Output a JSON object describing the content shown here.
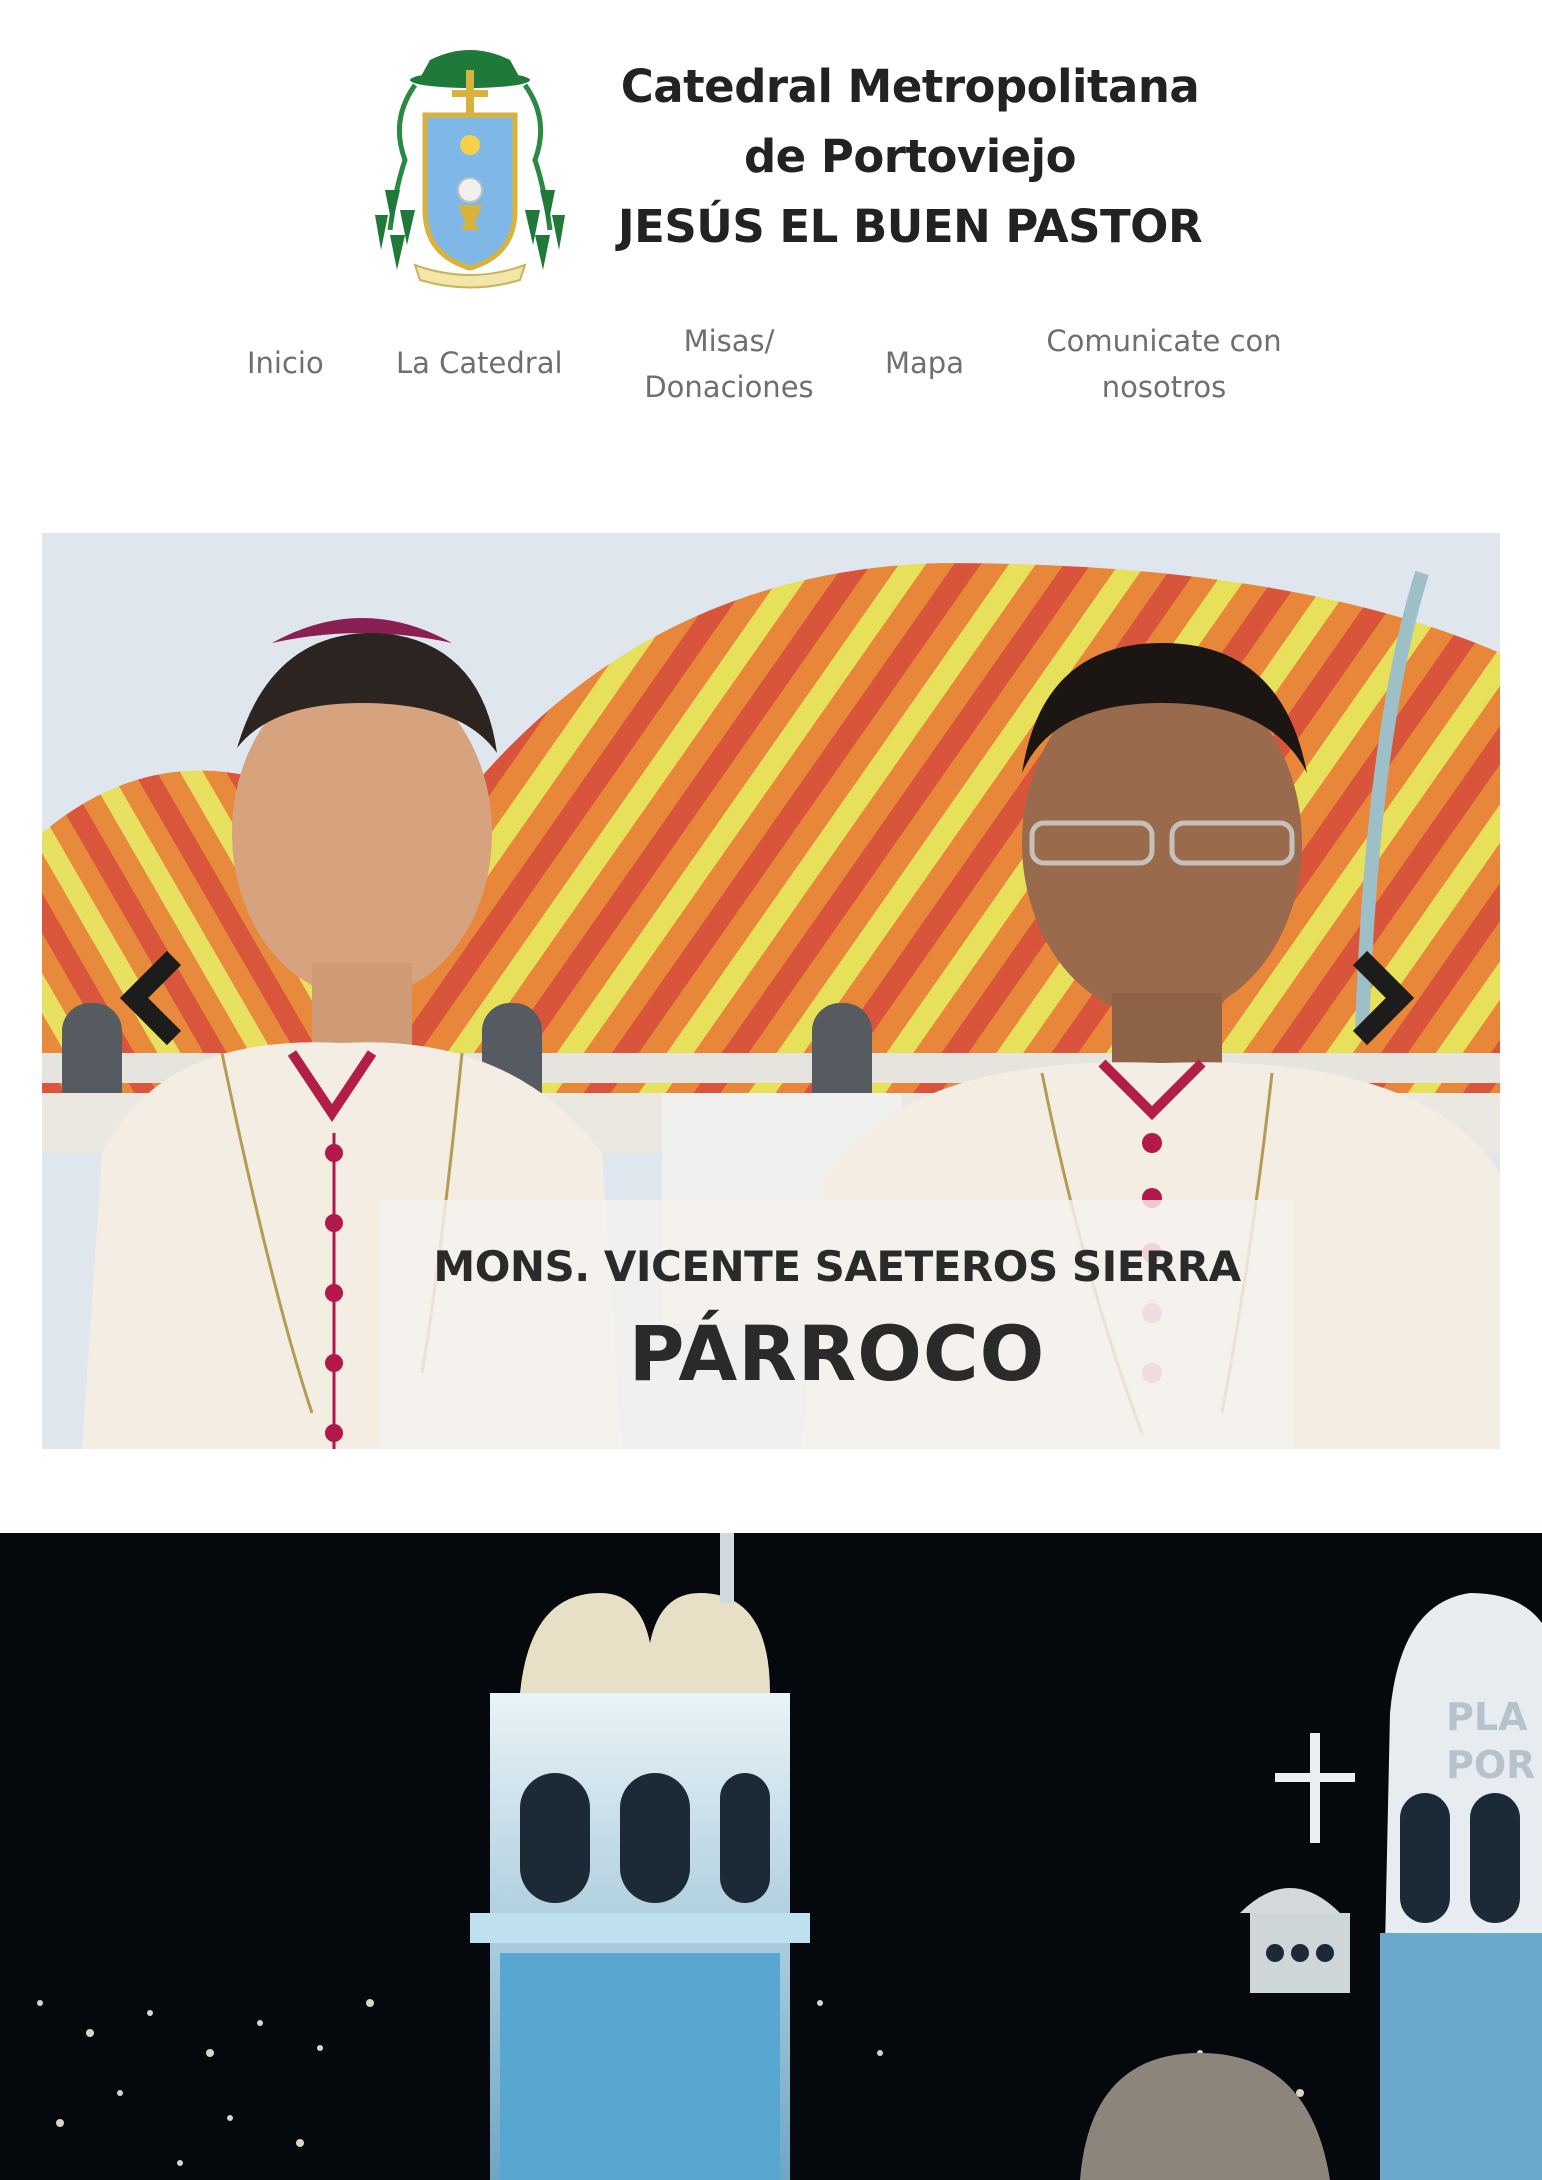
{
  "header": {
    "title_line1": "Catedral Metropolitana",
    "title_line2": "de Portoviejo",
    "title_line3": "JESÚS EL BUEN PASTOR",
    "logo_icon": "coat-of-arms-icon"
  },
  "nav": {
    "items": [
      {
        "line1": "Inicio",
        "line2": ""
      },
      {
        "line1": "La Catedral",
        "line2": ""
      },
      {
        "line1": "Misas/",
        "line2": "Donaciones"
      },
      {
        "line1": "Mapa",
        "line2": ""
      },
      {
        "line1": "Comunicate con",
        "line2": "nosotros"
      }
    ]
  },
  "slider": {
    "caption_name": "MONS. VICENTE SAETEROS SIERRA",
    "caption_role": "PÁRROCO",
    "prev_icon": "chevron-left-icon",
    "next_icon": "chevron-right-icon"
  },
  "banner": {
    "text_line1": "PLA",
    "text_line2": "POR"
  },
  "colors": {
    "title": "#222222",
    "nav_text": "#6f6f6f",
    "caption_bg": "#f5f2ee",
    "banner_bg": "#05080c"
  }
}
